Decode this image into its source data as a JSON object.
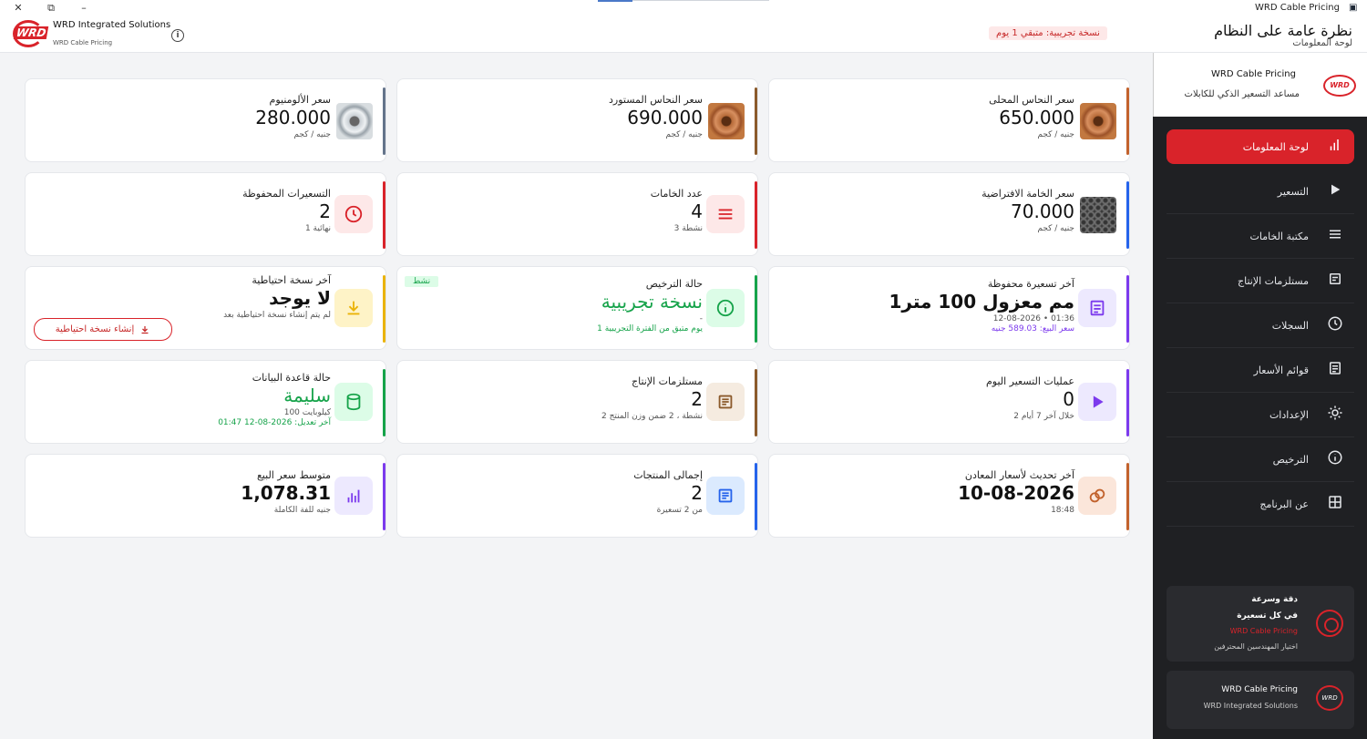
{
  "window": {
    "title": "WRD Cable Pricing"
  },
  "brand": {
    "name": "WRD Integrated Solutions",
    "sub": "WRD Cable Pricing",
    "logo_text": "WRD"
  },
  "header": {
    "trial_badge": "نسخة تجريبية: متبقي 1 يوم",
    "title": "نظرة عامة على النظام",
    "subtitle": "لوحة المعلومات"
  },
  "cards": {
    "alu": {
      "label": "سعر الألومنيوم",
      "value": "280.000",
      "unit": "جنيه / كجم"
    },
    "imported_copper": {
      "label": "سعر النحاس المستورد",
      "value": "690.000",
      "unit": "جنيه / كجم"
    },
    "local_copper": {
      "label": "سعر النحاس المحلى",
      "value": "650.000",
      "unit": "جنيه / كجم"
    },
    "saved_pricings": {
      "label": "التسعيرات المحفوظة",
      "value": "2",
      "sub": "1 نهائية"
    },
    "materials_count": {
      "label": "عدد الخامات",
      "value": "4",
      "sub": "3 نشطة"
    },
    "default_material": {
      "label": "سعر الخامة الافتراضية",
      "value": "70.000",
      "unit": "جنيه / كجم"
    },
    "last_backup": {
      "label": "آخر نسخة احتياطية",
      "value": "لا يوجد",
      "sub": "لم يتم إنشاء نسخة احتياطية بعد",
      "button": "إنشاء نسخة احتياطية"
    },
    "license": {
      "label": "حالة الترخيص",
      "value": "نسخة تجريبية",
      "dash": "-",
      "sub": "1 يوم متبق من الفترة التجريبية",
      "tag": "نشط"
    },
    "last_pricing": {
      "label": "آخر تسعيرة محفوظة",
      "value": "1مم معزول 100 متر",
      "date": "12-08-2026",
      "time": "01:36",
      "price": "سعر البيع: 589.03 جنيه"
    },
    "db_status": {
      "label": "حالة قاعدة البيانات",
      "value": "سليمة",
      "sub": "100 كيلوبايت",
      "modified": "آخر تعديل: 2026-08-12 01:47"
    },
    "production": {
      "label": "مستلزمات الإنتاج",
      "value": "2",
      "sub": "2 نشطة ، 2 ضمن وزن المنتج"
    },
    "today_ops": {
      "label": "عمليات التسعير اليوم",
      "value": "0",
      "sub": "2 خلال آخر 7 أيام"
    },
    "avg_price": {
      "label": "متوسط سعر البيع",
      "value": "1,078.31",
      "sub": "جنيه للفة الكاملة"
    },
    "total_products": {
      "label": "إجمالى المنتجات",
      "value": "2",
      "sub": "من 2 تسعيرة"
    },
    "metals_update": {
      "label": "آخر تحديث لأسعار المعادن",
      "value": "10-08-2026",
      "sub": "18:48"
    }
  },
  "sidebar": {
    "app_name": "WRD Cable Pricing",
    "tagline": "مساعد التسعير الذكي للكابلات",
    "items": [
      {
        "label": "لوحة المعلومات",
        "icon": "chart-bars-icon"
      },
      {
        "label": "التسعير",
        "icon": "play-icon"
      },
      {
        "label": "مكتبة الخامات",
        "icon": "menu-lines-icon"
      },
      {
        "label": "مستلزمات الإنتاج",
        "icon": "document-icon"
      },
      {
        "label": "السجلات",
        "icon": "clock-icon"
      },
      {
        "label": "قوائم الأسعار",
        "icon": "list-icon"
      },
      {
        "label": "الإعدادات",
        "icon": "gear-icon"
      },
      {
        "label": "الترخيص",
        "icon": "info-icon"
      },
      {
        "label": "عن البرنامج",
        "icon": "grid-icon"
      }
    ],
    "promo": {
      "line1": "دقة وسرعة",
      "line2": "في كل تسعيرة",
      "line3": "WRD Cable Pricing",
      "line4": "اختيار المهندسين المحترفين"
    },
    "about": {
      "line1": "WRD Cable Pricing",
      "line2": "WRD Integrated Solutions"
    }
  },
  "colors": {
    "accent": "#d9232a",
    "green": "#16a34a",
    "purple": "#7c3aed",
    "blue": "#2563eb",
    "brown": "#8b5a2b",
    "orange": "#c2622d",
    "slate": "#64748b",
    "yellow": "#eab308"
  }
}
